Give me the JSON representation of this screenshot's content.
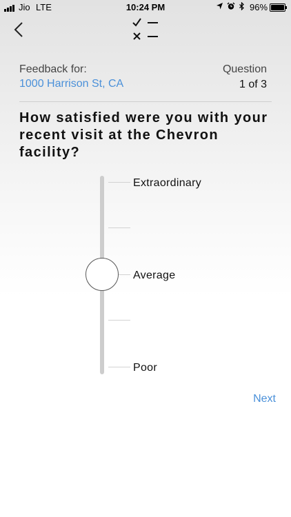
{
  "status_bar": {
    "carrier": "Jio",
    "network": "LTE",
    "time": "10:24 PM",
    "battery_percent": "96%",
    "icons": [
      "location-icon",
      "alarm-icon",
      "bluetooth-icon"
    ]
  },
  "nav": {
    "back_icon": "chevron-left-icon",
    "header_icon": "checklist-icon"
  },
  "header": {
    "feedback_label": "Feedback for:",
    "location": "1000 Harrison St, CA",
    "question_label": "Question",
    "question_count": "1 of 3"
  },
  "question": {
    "text": "How satisfied were you with your recent visit at the Chevron facility?"
  },
  "scale": {
    "options": [
      "Extraordinary",
      "",
      "Average",
      "",
      "Poor"
    ],
    "selected_index": 2,
    "selected_label": "Average"
  },
  "actions": {
    "next_label": "Next"
  },
  "colors": {
    "accent": "#4a90d9",
    "track": "#cdcdcd"
  }
}
